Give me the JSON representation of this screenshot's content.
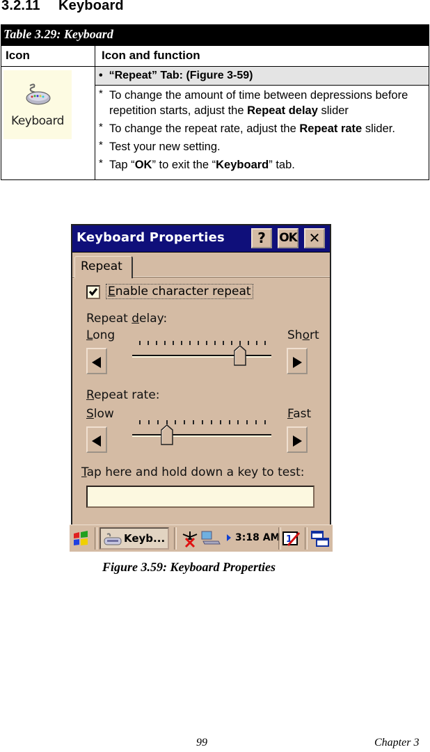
{
  "section": {
    "number": "3.2.11",
    "title": "Keyboard"
  },
  "table": {
    "caption": "Table 3.29: Keyboard",
    "headers": [
      "Icon",
      "Icon and function"
    ],
    "icon_label": "Keyboard",
    "icon_semantic": "keyboard-icon",
    "function_heading": "“Repeat” Tab: (Figure 3-59)",
    "bullet": "•",
    "steps": [
      {
        "pre": "To change the amount of time between depressions before repetition starts, adjust the ",
        "bold": "Repeat delay",
        "post": " slider"
      },
      {
        "pre": "To change the repeat rate, adjust the ",
        "bold": "Repeat rate",
        "post": " slider."
      },
      {
        "pre": "Test your new setting.",
        "bold": "",
        "post": ""
      },
      {
        "pre": "Tap “",
        "bold": "OK",
        "mid": "” to exit the “",
        "bold2": "Keyboard",
        "post": "” tab."
      }
    ],
    "step_marker": "*"
  },
  "dialog": {
    "title": "Keyboard Properties",
    "buttons": {
      "help": "?",
      "ok": "OK",
      "close": "✕"
    },
    "tabs": [
      {
        "label": "Repeat",
        "active": true
      }
    ],
    "enable_repeat": {
      "label_first": "E",
      "label_rest": "nable character repeat",
      "checked": true
    },
    "delay": {
      "label_pre": "Repeat ",
      "label_u": "d",
      "label_post": "elay:",
      "left_u": "L",
      "left_rest": "ong",
      "right_pre": "Sh",
      "right_u": "o",
      "right_post": "rt",
      "tick_count": 16,
      "value_index": 12
    },
    "rate": {
      "label_u": "R",
      "label_rest": "epeat rate:",
      "left_u": "S",
      "left_rest": "low",
      "right_u": "F",
      "right_rest": "ast",
      "tick_count": 15,
      "value_index": 3
    },
    "test": {
      "label_u": "T",
      "label_rest": "ap here and hold down a key to test:",
      "value": ""
    }
  },
  "taskbar": {
    "task_label": "Keyb...",
    "clock": "3:18 AM"
  },
  "figure_caption": "Figure 3.59:  Keyboard Properties",
  "footer": {
    "page": "99",
    "chapter": "Chapter 3"
  },
  "colors": {
    "titlebar": "#0f0f7a",
    "dialog_bg": "#d4bba4",
    "input_bg": "#fcf8e0",
    "row_shade": "#e4e4e4"
  }
}
